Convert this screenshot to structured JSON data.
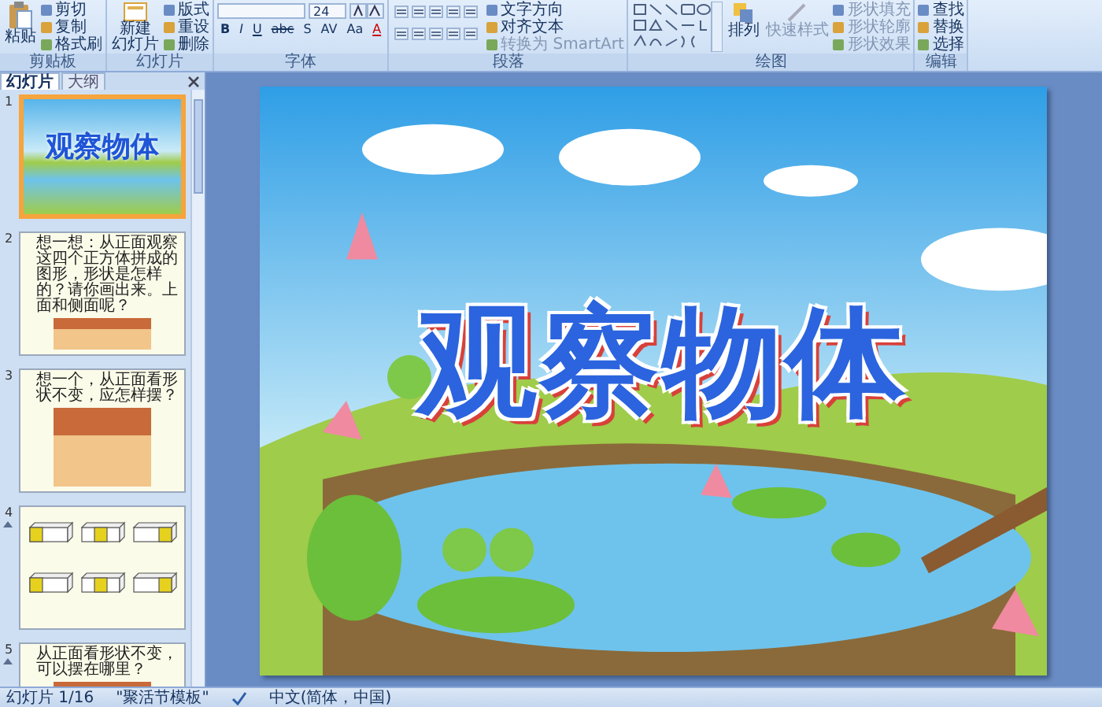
{
  "ribbon": {
    "groups": [
      {
        "kind": "clipboard",
        "label": "剪贴板",
        "big": [
          "粘贴"
        ],
        "items": [
          "剪切",
          "复制",
          "格式刷"
        ]
      },
      {
        "kind": "slides",
        "label": "幻灯片",
        "big": [
          "新建",
          "幻灯片"
        ],
        "items": [
          "版式",
          "重设",
          "删除"
        ]
      },
      {
        "kind": "font",
        "label": "字体",
        "size": "24",
        "buttons": [
          "B",
          "I",
          "U",
          "abc",
          "S",
          "AV",
          "Aa",
          "A"
        ]
      },
      {
        "kind": "paragraph",
        "label": "段落",
        "items": [
          "文字方向",
          "对齐文本",
          "转换为 SmartArt"
        ]
      },
      {
        "kind": "drawing",
        "label": "绘图",
        "big": [
          "排列"
        ],
        "quick": "快速样式",
        "items": [
          "形状填充",
          "形状轮廓",
          "形状效果"
        ]
      },
      {
        "kind": "editing",
        "label": "编辑",
        "items": [
          "查找",
          "替换",
          "选择"
        ]
      }
    ]
  },
  "pane": {
    "tabs": [
      {
        "label": "幻灯片",
        "selected": true
      },
      {
        "label": "大纲",
        "selected": false
      }
    ],
    "slides": [
      {
        "number": "1",
        "kind": "title",
        "selected": true,
        "animated": false,
        "text": "观察物体"
      },
      {
        "number": "2",
        "kind": "picture",
        "selected": false,
        "animated": false,
        "text": "想一想：从正面观察这四个正方体拼成的图形，形状是怎样的？请你画出来。上面和侧面呢？"
      },
      {
        "number": "3",
        "kind": "picture",
        "selected": false,
        "animated": false,
        "text": "想一个，从正面看形状不变，应怎样摆？"
      },
      {
        "number": "4",
        "kind": "cubes",
        "selected": false,
        "animated": true
      },
      {
        "number": "5",
        "kind": "picture",
        "selected": false,
        "animated": true,
        "text": "从正面看形状不变，可以摆在哪里？"
      }
    ]
  },
  "slide": {
    "title": "观察物体"
  },
  "status_bar": {
    "slide": "幻灯片 1/16",
    "theme": "\"聚活节模板\"",
    "language": "中文(简体，中国)"
  }
}
